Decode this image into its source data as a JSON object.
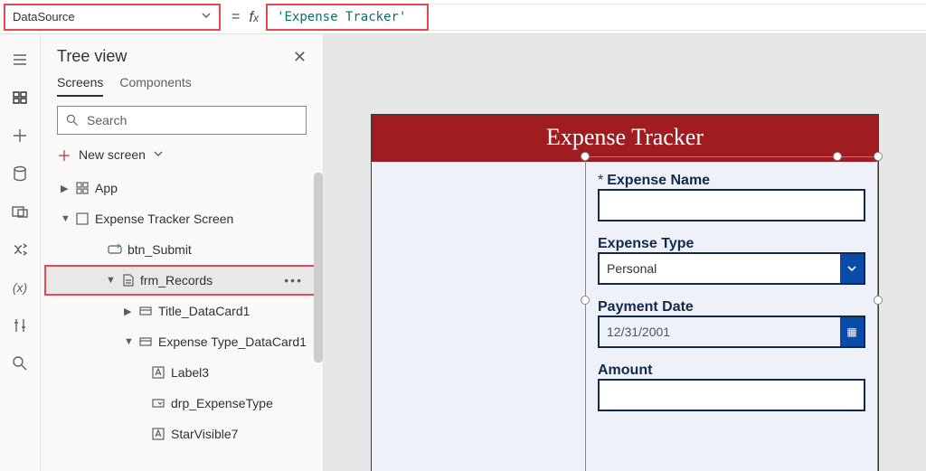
{
  "formula_bar": {
    "property": "DataSource",
    "expression": "'Expense Tracker'"
  },
  "tree": {
    "title": "Tree view",
    "tabs": {
      "screens": "Screens",
      "components": "Components"
    },
    "search_placeholder": "Search",
    "new_screen": "New screen",
    "nodes": {
      "app": "App",
      "screen": "Expense Tracker Screen",
      "btn": "btn_Submit",
      "form": "frm_Records",
      "title_card": "Title_DataCard1",
      "type_card": "Expense Type_DataCard1",
      "label3": "Label3",
      "drp": "drp_ExpenseType",
      "star": "StarVisible7"
    }
  },
  "app": {
    "header": "Expense Tracker",
    "fields": {
      "name_label": "Expense Name",
      "type_label": "Expense Type",
      "type_value": "Personal",
      "date_label": "Payment Date",
      "date_value": "12/31/2001",
      "amount_label": "Amount"
    }
  }
}
